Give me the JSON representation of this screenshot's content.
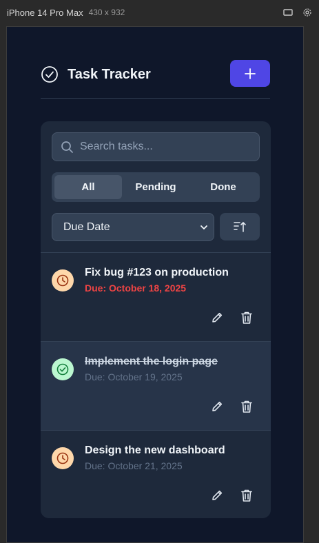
{
  "devtools": {
    "device_name": "iPhone 14 Pro Max",
    "device_size": "430 x 932"
  },
  "header": {
    "title": "Task Tracker"
  },
  "search": {
    "placeholder": "Search tasks..."
  },
  "filters": [
    {
      "label": "All",
      "active": true
    },
    {
      "label": "Pending",
      "active": false
    },
    {
      "label": "Done",
      "active": false
    }
  ],
  "sort": {
    "selected": "Due Date"
  },
  "tasks": [
    {
      "name": "Fix bug #123 on production",
      "due": "Due: October 18, 2025",
      "status": "pending",
      "overdue": true
    },
    {
      "name": "Implement the login page",
      "due": "Due: October 19, 2025",
      "status": "done",
      "overdue": false
    },
    {
      "name": "Design the new dashboard",
      "due": "Due: October 21, 2025",
      "status": "pending",
      "overdue": false
    }
  ],
  "colors": {
    "accent": "#4f46e5",
    "background": "#0f172a",
    "card": "#1e293b",
    "overdue": "#ef4444",
    "pending_badge": "#fed7aa",
    "done_badge": "#bbf7d0"
  }
}
